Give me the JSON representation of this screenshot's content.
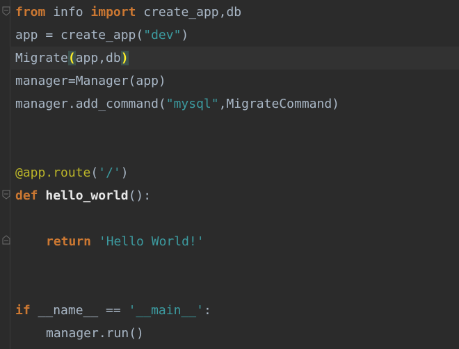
{
  "code": {
    "l1": {
      "kw1": "from",
      "mod": " info ",
      "kw2": "import",
      "rest": " create_app,db"
    },
    "l2": {
      "a": "app = create_app(",
      "s": "\"dev\"",
      "b": ")"
    },
    "l3": {
      "a": "Migrate",
      "p1": "(",
      "b": "app,db",
      "p2": ")"
    },
    "l4": {
      "a": "manager=Manager(app)"
    },
    "l5": {
      "a": "manager.add_command(",
      "s": "\"mysql\"",
      "b": ",MigrateCommand)"
    },
    "l6": {
      "at": "@",
      "dec": "app.route",
      "a": "(",
      "s": "'/'",
      "b": ")"
    },
    "l7": {
      "kw": "def",
      "sp": " ",
      "fn": "hello_world",
      "b": "():"
    },
    "l8": {
      "kw": "return",
      "sp": " ",
      "s": "'Hello World!'"
    },
    "l9": {
      "kw": "if",
      "a": " __name__ == ",
      "s": "'__main__'",
      "b": ":"
    },
    "l10": {
      "a": "manager.run()"
    }
  },
  "colors": {
    "background": "#2b2b2b",
    "keyword": "#cc7832",
    "string": "#3c9ba0",
    "decorator": "#bbb529",
    "text": "#a9b7c6"
  }
}
